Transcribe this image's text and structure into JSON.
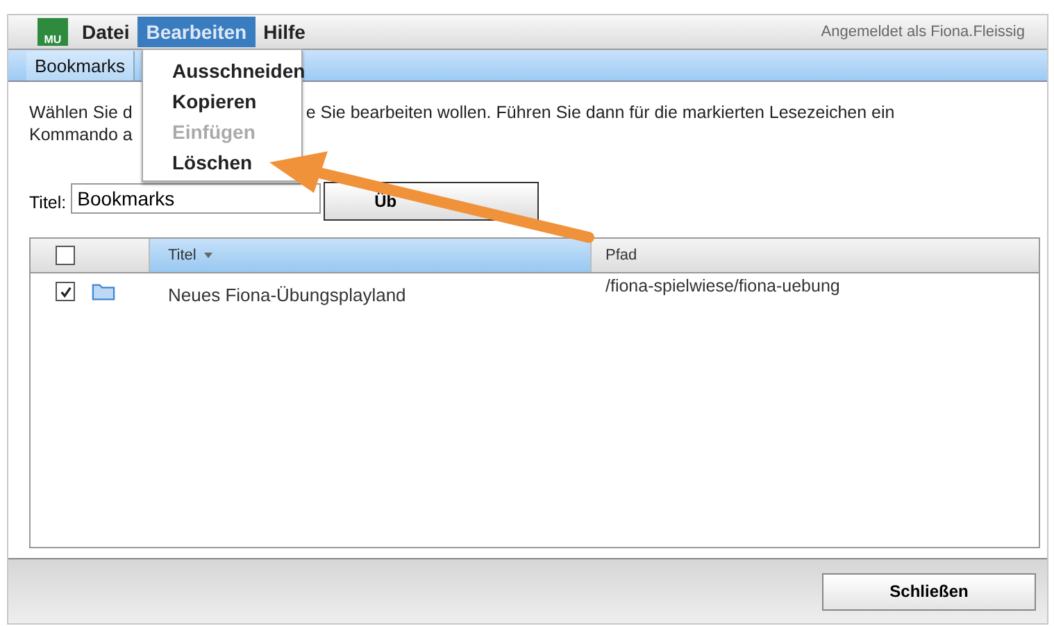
{
  "menu_bar": {
    "logo": "MU",
    "items": [
      {
        "label": "Datei",
        "selected": false
      },
      {
        "label": "Bearbeiten",
        "selected": true
      },
      {
        "label": "Hilfe",
        "selected": false
      }
    ],
    "user": "Angemeldet als Fiona.Fleissig"
  },
  "tabs": [
    {
      "label": "Bookmarks",
      "selected": true
    }
  ],
  "dropdown": {
    "items": [
      {
        "label": "Ausschneiden",
        "disabled": false
      },
      {
        "label": "Kopieren",
        "disabled": false
      },
      {
        "label": "Einfügen",
        "disabled": true
      },
      {
        "label": "Löschen",
        "disabled": false
      }
    ]
  },
  "instructions": {
    "line_1_left": "Wählen Sie d",
    "line_1_right": "e Sie bearbeiten wollen. Führen Sie dann für die markierten Lesezeichen ein",
    "line_2": "Kommando a"
  },
  "title_field": {
    "label": "Titel:",
    "value": "Bookmarks"
  },
  "apply_button": {
    "label": "Üb"
  },
  "table": {
    "columns": [
      {
        "label": "Titel",
        "sorted": true
      },
      {
        "label": "Pfad",
        "sorted": false
      }
    ],
    "header_checked": false,
    "rows": [
      {
        "checked": true,
        "title": "Neues Fiona-Übungsplayland",
        "path": "/fiona-spielwiese/fiona-uebung"
      }
    ]
  },
  "close_button": {
    "label": "Schließen"
  }
}
